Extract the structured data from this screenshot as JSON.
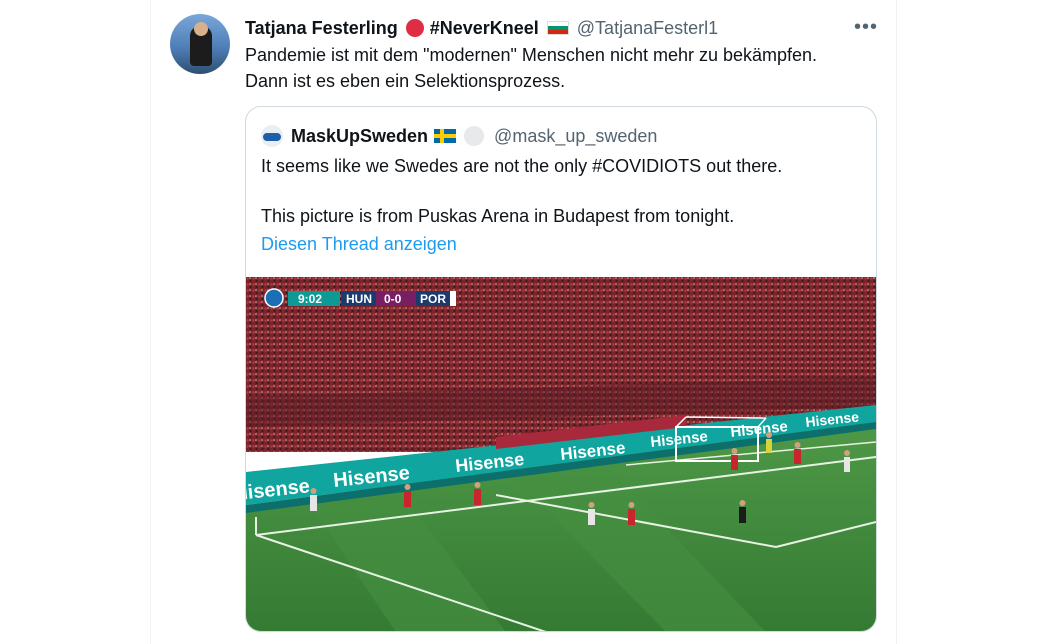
{
  "tweet": {
    "author_name": "Tatjana Festerling",
    "hashtag": "#NeverKneel",
    "handle": "@TatjanaFesterl1",
    "text_lines": [
      "Pandemie ist mit dem \"modernen\" Menschen nicht mehr zu bekämpfen.",
      "Dann ist es eben ein Selektionsprozess."
    ],
    "more_icon": "more-horizontal-icon"
  },
  "quoted_tweet": {
    "author_name": "MaskUpSweden",
    "handle": "@mask_up_sweden",
    "paragraphs": [
      "It seems like we Swedes are not the only #COVIDIOTS out there.",
      "This picture is from Puskas Arena in Budapest from tonight."
    ],
    "show_thread_label": "Diesen Thread anzeigen"
  },
  "media": {
    "scoreboard": {
      "time": "9:02",
      "home": "HUN",
      "score": "0-0",
      "away": "POR"
    },
    "ad_board_text": "Hisense"
  },
  "colors": {
    "link": "#1d9bf0",
    "secondary_text": "#536471",
    "border": "#cfd9de",
    "pitch": "#3f8a3c"
  }
}
